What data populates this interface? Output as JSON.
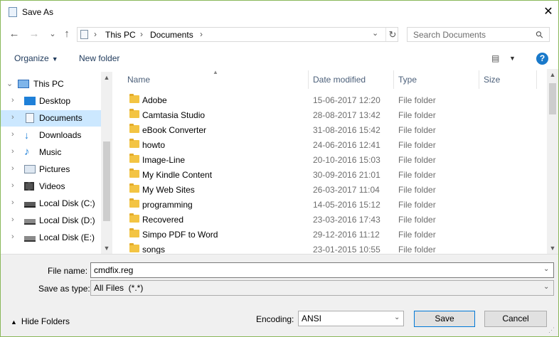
{
  "window": {
    "title": "Save As",
    "close": "✕"
  },
  "nav": {
    "back": "←",
    "forward": "→",
    "recent": "⌄",
    "up": "↑",
    "crumb_sep": "›",
    "crumbs": [
      "This PC",
      "Documents"
    ],
    "dropdown": "⌄",
    "refresh": "↻"
  },
  "search": {
    "placeholder": "Search Documents"
  },
  "toolbar": {
    "organize": "Organize",
    "new_folder": "New folder",
    "view_icon": "▤",
    "help": "?"
  },
  "sidebar": {
    "items": [
      {
        "label": "This PC",
        "icon": "computer-icon",
        "expanded": true
      },
      {
        "label": "Desktop",
        "icon": "desktop-icon"
      },
      {
        "label": "Documents",
        "icon": "documents-icon",
        "selected": true
      },
      {
        "label": "Downloads",
        "icon": "downloads-icon"
      },
      {
        "label": "Music",
        "icon": "music-icon"
      },
      {
        "label": "Pictures",
        "icon": "pictures-icon"
      },
      {
        "label": "Videos",
        "icon": "videos-icon"
      },
      {
        "label": "Local Disk (C:)",
        "icon": "drive-icon"
      },
      {
        "label": "Local Disk (D:)",
        "icon": "drive-icon"
      },
      {
        "label": "Local Disk (E:)",
        "icon": "drive-icon"
      }
    ]
  },
  "columns": {
    "name": "Name",
    "date": "Date modified",
    "type": "Type",
    "size": "Size"
  },
  "files": [
    {
      "name": "Adobe",
      "date": "15-06-2017 12:20",
      "type": "File folder"
    },
    {
      "name": "Camtasia Studio",
      "date": "28-08-2017 13:42",
      "type": "File folder"
    },
    {
      "name": "eBook Converter",
      "date": "31-08-2016 15:42",
      "type": "File folder"
    },
    {
      "name": "howto",
      "date": "24-06-2016 12:41",
      "type": "File folder"
    },
    {
      "name": "Image-Line",
      "date": "20-10-2016 15:03",
      "type": "File folder"
    },
    {
      "name": "My Kindle Content",
      "date": "30-09-2016 21:01",
      "type": "File folder"
    },
    {
      "name": "My Web Sites",
      "date": "26-03-2017 11:04",
      "type": "File folder"
    },
    {
      "name": "programming",
      "date": "14-05-2016 15:12",
      "type": "File folder"
    },
    {
      "name": "Recovered",
      "date": "23-03-2016 17:43",
      "type": "File folder"
    },
    {
      "name": "Simpo PDF to Word",
      "date": "29-12-2016 11:12",
      "type": "File folder"
    },
    {
      "name": "songs",
      "date": "23-01-2015 10:55",
      "type": "File folder"
    }
  ],
  "form": {
    "filename_label": "File name:",
    "filename_value": "cmdfix.reg",
    "savetype_label": "Save as type:",
    "savetype_value": "All Files  (*.*)"
  },
  "footer": {
    "hide_folders": "Hide Folders",
    "encoding_label": "Encoding:",
    "encoding_value": "ANSI",
    "save": "Save",
    "cancel": "Cancel"
  }
}
